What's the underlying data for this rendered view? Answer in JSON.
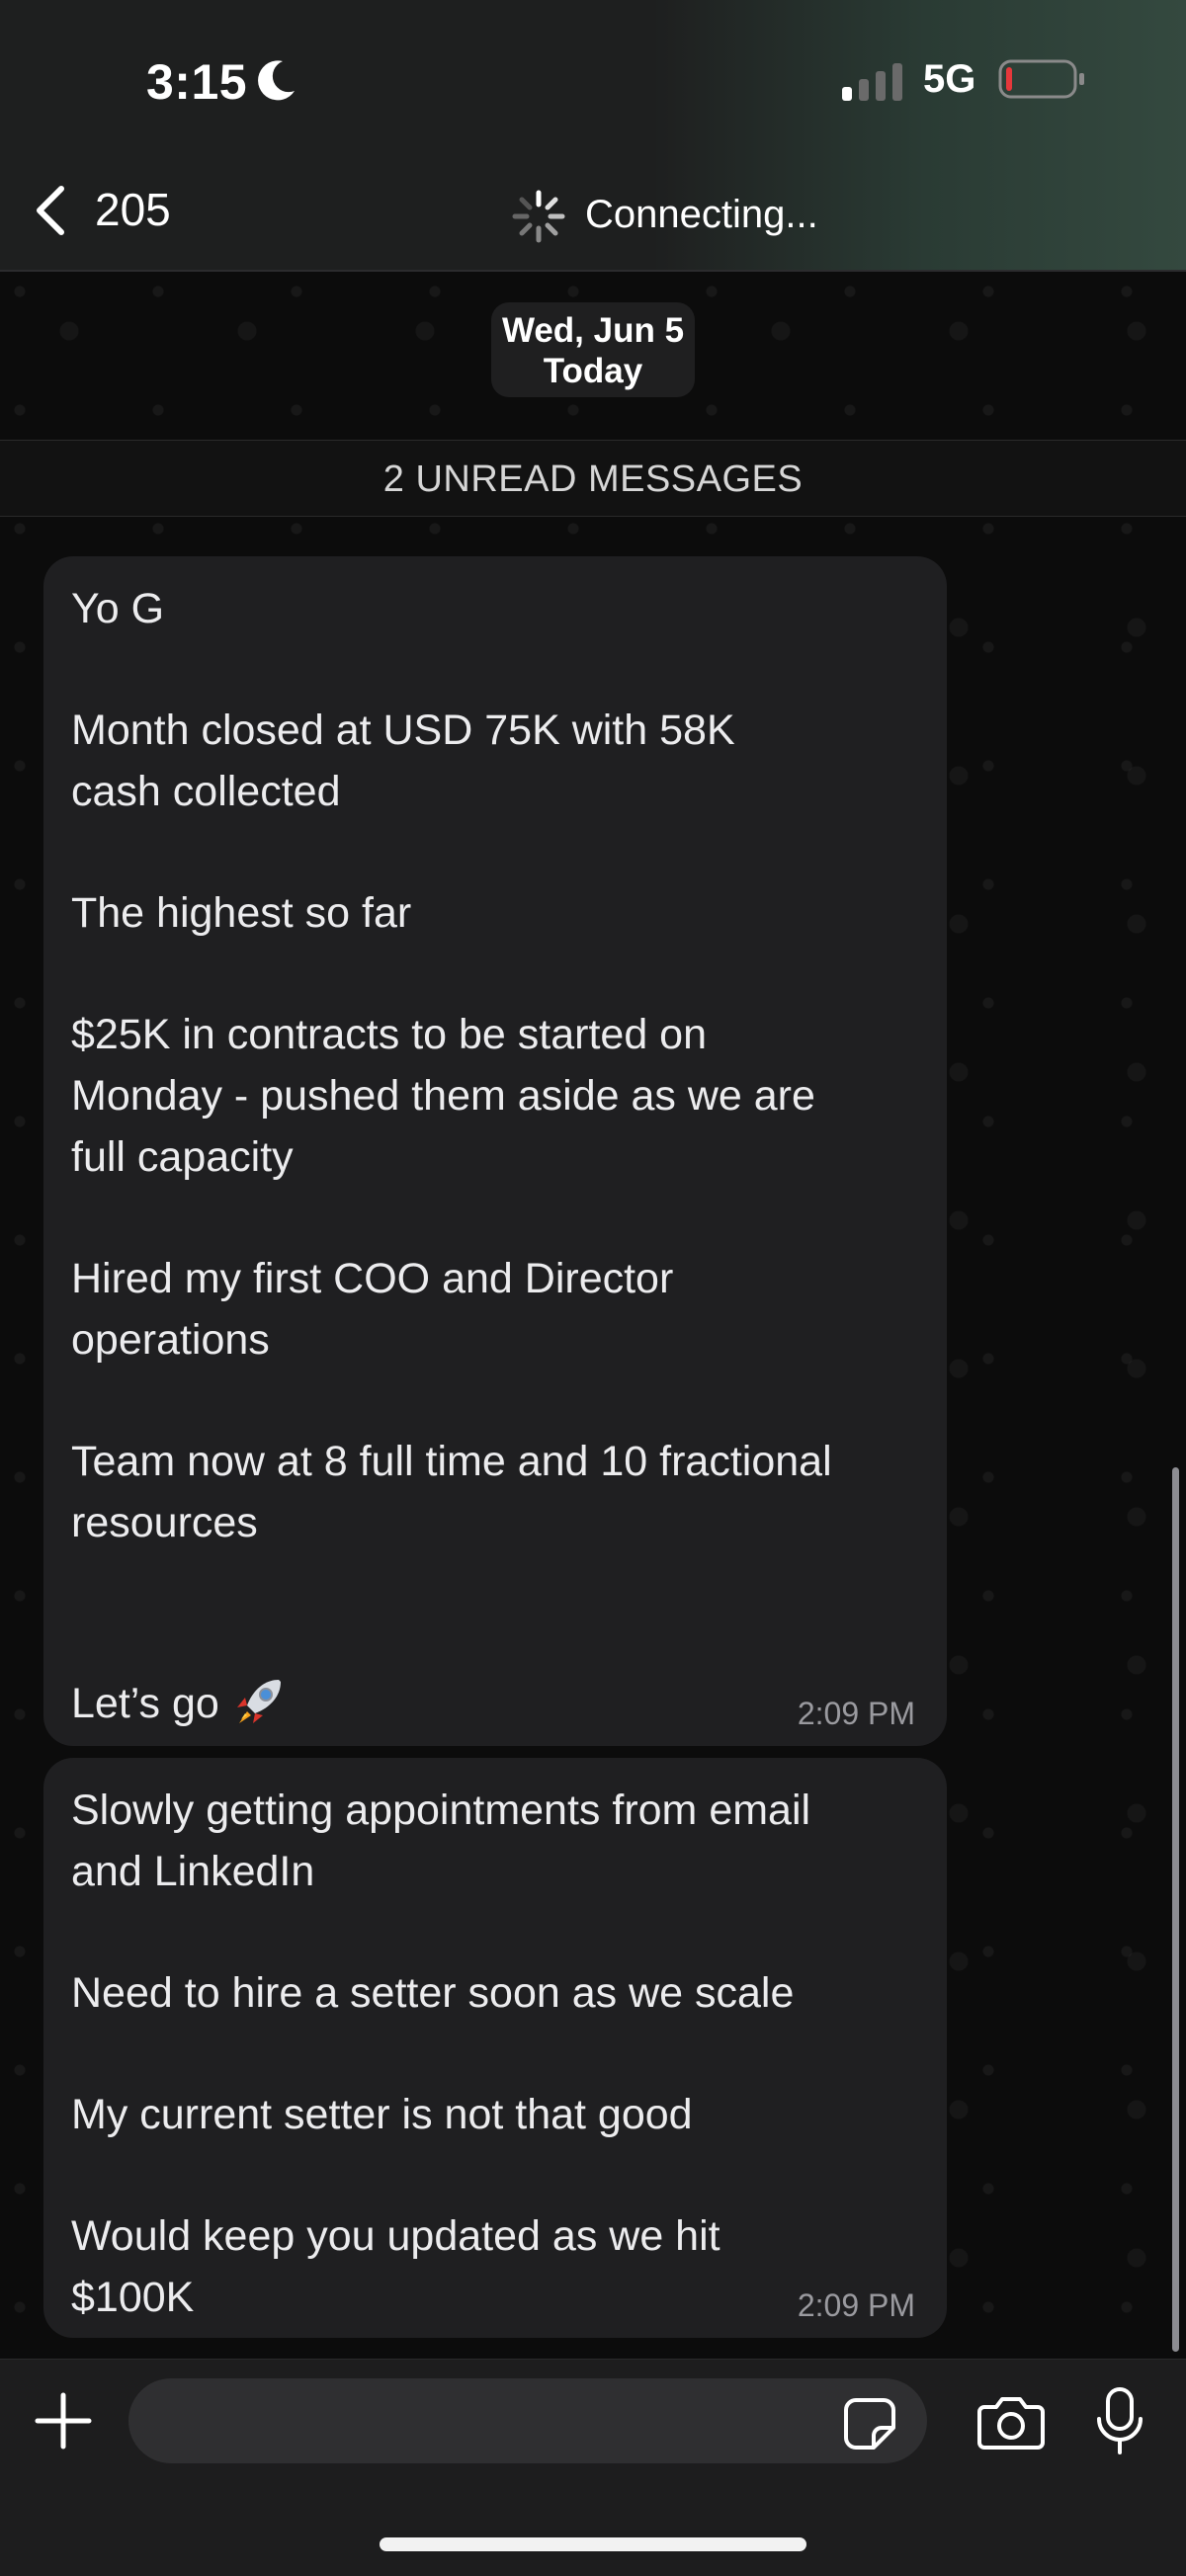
{
  "status_bar": {
    "time": "3:15",
    "network": "5G"
  },
  "nav": {
    "back_count": "205",
    "connecting_text": "Connecting..."
  },
  "date_pill": {
    "date": "Wed, Jun 5",
    "day": "Today"
  },
  "unread_banner": "2 UNREAD MESSAGES",
  "messages": [
    {
      "lines": [
        "Yo G",
        "Month closed at USD 75K with 58K",
        "cash collected",
        "The highest so far",
        "$25K in contracts to be started on",
        "Monday - pushed them aside as we are",
        "full capacity",
        "Hired my first COO and Director",
        "operations",
        "Team now at 8 full time and 10 fractional",
        "resources",
        "Let’s go"
      ],
      "time": "2:09 PM"
    },
    {
      "lines": [
        "Slowly getting appointments from email",
        "and LinkedIn",
        "Need to hire a setter soon as we scale",
        "My current setter is not that good",
        "Would keep you updated as we hit",
        "$100K"
      ],
      "time": "2:09 PM"
    }
  ],
  "input": {
    "value": "",
    "placeholder": ""
  },
  "icons": {
    "moon": "moon-icon",
    "signal": "signal-icon",
    "battery": "battery-icon",
    "back": "chevron-left-icon",
    "spinner": "spinner-icon",
    "rocket": "rocket-emoji-icon",
    "plus": "plus-icon",
    "sticker": "sticker-icon",
    "camera": "camera-icon",
    "mic": "microphone-icon"
  },
  "colors": {
    "bubble": "#1f1f21",
    "battery_low": "#e5383b",
    "timestamp": "#9a9a9f"
  }
}
